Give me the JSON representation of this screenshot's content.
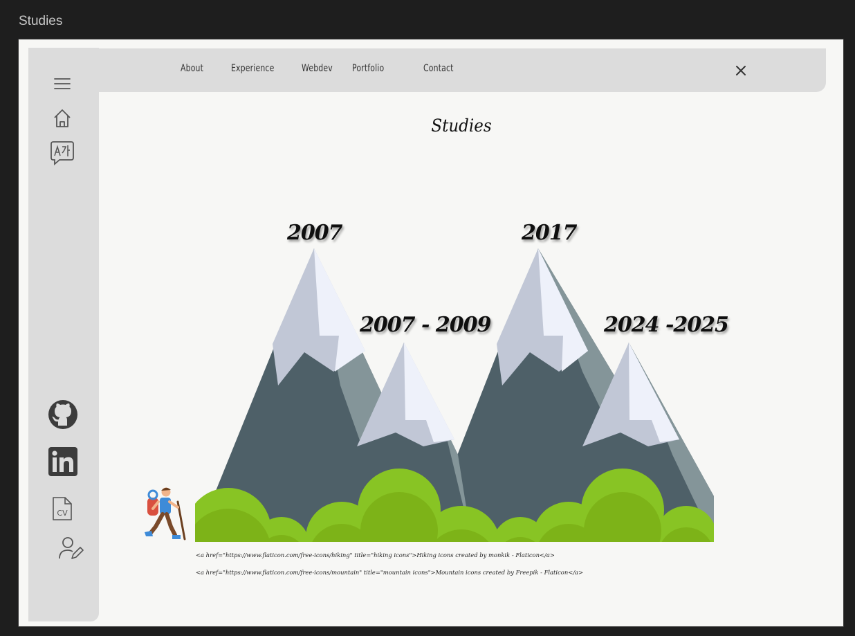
{
  "window": {
    "title": "Studies"
  },
  "nav": {
    "links": [
      "About",
      "Experience",
      "Webdev",
      "Portfolio",
      "Contact"
    ],
    "close_icon": "close-icon"
  },
  "sidebar": {
    "icons": [
      "menu-icon",
      "home-icon",
      "translate-icon",
      "github-icon",
      "linkedin-icon",
      "cv-icon",
      "user-edit-icon"
    ],
    "cv_label": "CV"
  },
  "main": {
    "heading": "Studies",
    "milestones": [
      {
        "label": "2007"
      },
      {
        "label": "2007 - 2009"
      },
      {
        "label": "2017"
      },
      {
        "label": "2024 -2025"
      }
    ],
    "credits": [
      "<a href=\"https://www.flaticon.com/free-icons/hiking\" title=\"hiking icons\">Hiking icons created by monkik - Flaticon</a>",
      "<a href=\"https://www.flaticon.com/free-icons/mountain\" title=\"mountain icons\">Mountain icons created by Freepik - Flaticon</a>"
    ]
  },
  "colors": {
    "background": "#1e1e1e",
    "page": "#f7f7f5",
    "panel": "#dcdcdc",
    "mountain_dark": "#4e6068",
    "mountain_mid": "#849599",
    "snow": "#c1c7d6",
    "snow_light": "#eef1fa",
    "bush_light": "#88c424",
    "bush_dark": "#7db318"
  }
}
